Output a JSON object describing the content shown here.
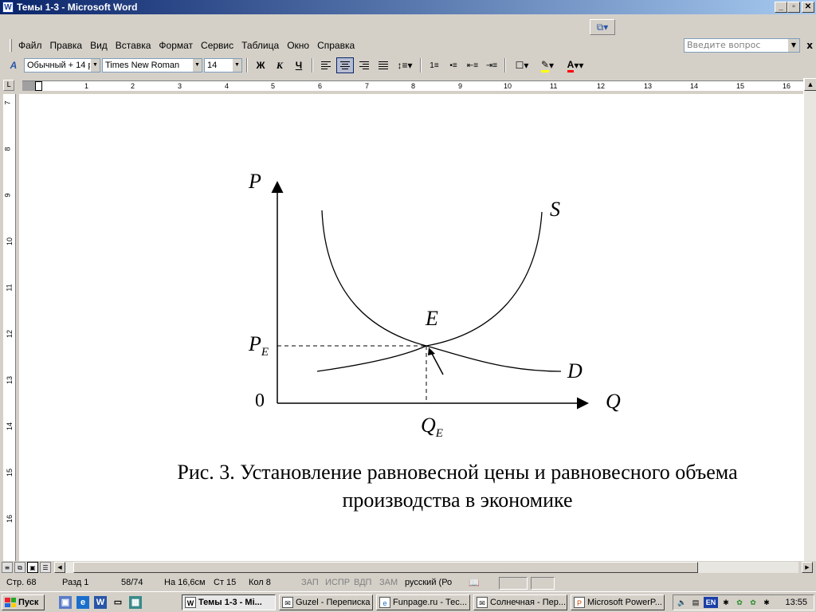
{
  "window": {
    "title": "Темы 1-3 - Microsoft Word",
    "app_icon": "W",
    "controls": {
      "minimize": "_",
      "maximize": "▫",
      "close": "✕"
    }
  },
  "menu": {
    "items": [
      "Файл",
      "Правка",
      "Вид",
      "Вставка",
      "Формат",
      "Сервис",
      "Таблица",
      "Окно",
      "Справка"
    ],
    "ask_placeholder": "Введите вопрос",
    "close_doc": "x"
  },
  "format_toolbar": {
    "style": "Обычный + 14 p",
    "font": "Times New Roman",
    "size": "14",
    "bold": "Ж",
    "italic": "К",
    "underline": "Ч",
    "font_color_letter": "A",
    "highlight_color": "#ffff00",
    "font_color": "#ff0000"
  },
  "ruler": {
    "corner": "L",
    "marks": [
      "1",
      "2",
      "3",
      "4",
      "5",
      "6",
      "7",
      "8",
      "9",
      "10",
      "11",
      "12",
      "13",
      "14",
      "15",
      "16"
    ],
    "vertical_marks": [
      "7",
      "8",
      "9",
      "10",
      "11",
      "12",
      "13",
      "14",
      "15",
      "16"
    ]
  },
  "chart_data": {
    "type": "line",
    "y_axis_label": "P",
    "x_axis_label": "Q",
    "origin_label": "0",
    "equilibrium_label": "E",
    "pe_label_main": "P",
    "pe_label_sub": "E",
    "qe_label_main": "Q",
    "qe_label_sub": "E",
    "series": [
      {
        "name": "S",
        "shape": "U-shaped, rising to the right"
      },
      {
        "name": "D",
        "shape": "descending, decreasing slope"
      }
    ]
  },
  "caption": {
    "line1": "Рис. 3. Установление равновесной цены и равновесного объема",
    "line2": "производства в экономике"
  },
  "statusbar": {
    "page": "Стр. 68",
    "section": "Разд 1",
    "pages": "58/74",
    "position": "На 16,6см",
    "line": "Ст 15",
    "col": "Кол 8",
    "rec": "ЗАП",
    "trk": "ИСПР",
    "ext": "ВДП",
    "ovr": "ЗАМ",
    "language": "русский (Ро"
  },
  "taskbar": {
    "start": "Пуск",
    "tasks": [
      {
        "label": "Темы 1-3 - Mi...",
        "icon": "W",
        "active": true
      },
      {
        "label": "Guzel - Переписка",
        "icon": "✉",
        "active": false
      },
      {
        "label": "Funpage.ru - Тес...",
        "icon": "e",
        "active": false
      },
      {
        "label": "Солнечная - Пер...",
        "icon": "✉",
        "active": false
      },
      {
        "label": "Microsoft PowerP...",
        "icon": "P",
        "active": false
      }
    ],
    "tray_lang": "EN",
    "clock": "13:55"
  }
}
